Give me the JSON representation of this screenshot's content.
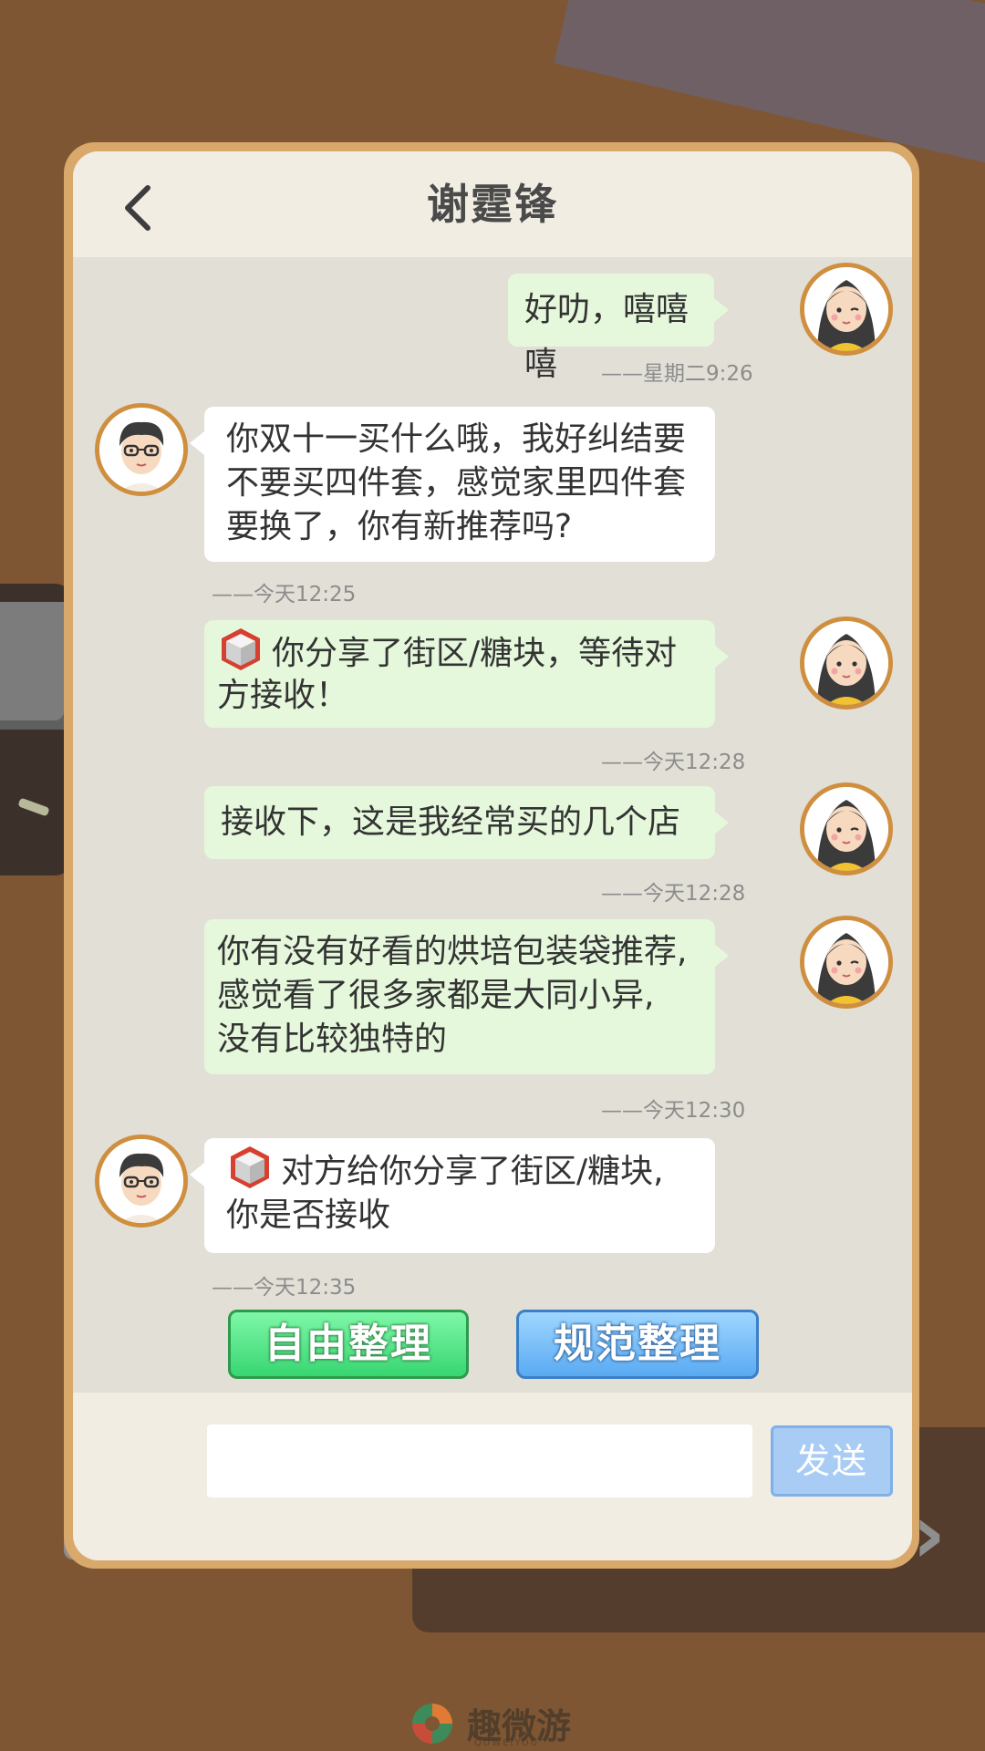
{
  "header": {
    "title": "谢霆锋"
  },
  "messages": [
    {
      "side": "me",
      "text": "好叻，嘻嘻嘻",
      "time": "——星期二9:26"
    },
    {
      "side": "other",
      "lines": [
        "你双十一买什么哦，我好纠结要",
        "不要买四件套，感觉家里四件套",
        "要换了，你有新推荐吗?"
      ],
      "time": "——今天12:25"
    },
    {
      "side": "me",
      "icon": "block-cube-icon",
      "lines": [
        "你分享了街区/糖块，等待对",
        "方接收！"
      ],
      "time": "——今天12:28"
    },
    {
      "side": "me",
      "text": "接收下，这是我经常买的几个店",
      "time": "——今天12:28"
    },
    {
      "side": "me",
      "lines": [
        "你有没有好看的烘培包装袋推荐,",
        "感觉看了很多家都是大同小异,",
        "没有比较独特的"
      ],
      "time": "——今天12:30"
    },
    {
      "side": "other",
      "icon": "block-cube-icon",
      "lines": [
        "对方给你分享了街区/糖块,",
        "你是否接收"
      ],
      "time": "——今天12:35"
    }
  ],
  "actions": {
    "free_sort": "自由整理",
    "standard_sort": "规范整理"
  },
  "composer": {
    "placeholder": "",
    "send": "发送"
  },
  "watermark": {
    "name": "趣微游",
    "sub": "QUWEIYOU"
  },
  "colors": {
    "me_bubble": "#e6f8dc",
    "other_bubble": "#ffffff",
    "frame": "#d9a86b",
    "free_btn": "#38d672",
    "standard_btn": "#5aaaf2",
    "send_btn": "#a9ccf5"
  }
}
